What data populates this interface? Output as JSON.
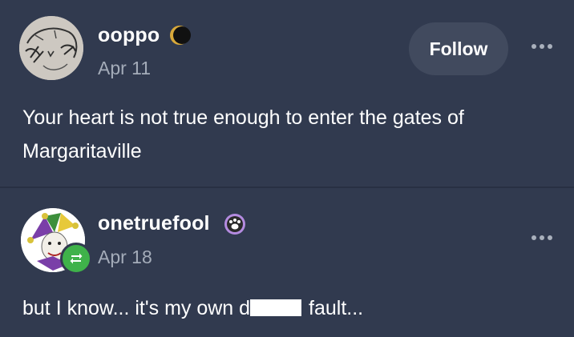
{
  "posts": [
    {
      "username": "ooppo",
      "date": "Apr 11",
      "follow_label": "Follow",
      "badge_icon": "crescent-moon-icon",
      "text": "Your heart is not true enough to enter the gates of Margaritaville"
    },
    {
      "username": "onetruefool",
      "date": "Apr 18",
      "badge_icon": "paw-badge-icon",
      "reblog_icon": "reblog-icon",
      "text_before": "but I know... it's my own d",
      "text_after": " fault..."
    }
  ],
  "colors": {
    "background": "#313a4f",
    "follow_bg": "#414a5e",
    "date": "#a4acb9",
    "reblog_green": "#3fb24a"
  }
}
